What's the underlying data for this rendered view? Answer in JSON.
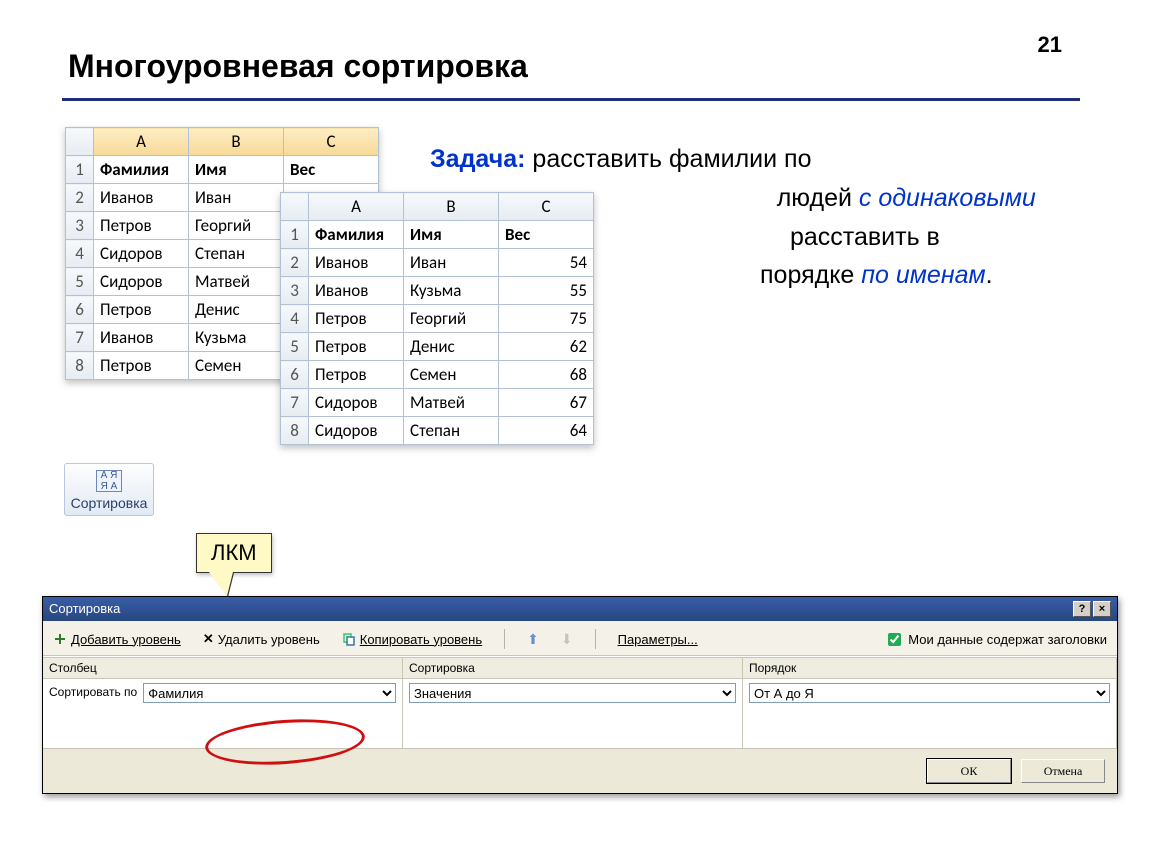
{
  "page_number": "21",
  "title": "Многоуровневая сортировка",
  "task": {
    "label": "Задача:",
    "line1a": "расставить фамилии по",
    "line2a": "людей ",
    "line2b": "с одинаковыми",
    "line3a": "расставить в",
    "line4a": "порядке ",
    "line4b": "по именам",
    "line4c": "."
  },
  "sort_button_label": "Сортировка",
  "callout": "ЛКМ",
  "cols": {
    "A": "A",
    "B": "B",
    "C": "C"
  },
  "headers": {
    "surname": "Фамилия",
    "name": "Имя",
    "weight": "Вес"
  },
  "table1_rows": [
    {
      "n": "1",
      "a": "Фамилия",
      "b": "Имя",
      "c": "Вес",
      "hdr": true
    },
    {
      "n": "2",
      "a": "Иванов",
      "b": "Иван"
    },
    {
      "n": "3",
      "a": "Петров",
      "b": "Георгий"
    },
    {
      "n": "4",
      "a": "Сидоров",
      "b": "Степан"
    },
    {
      "n": "5",
      "a": "Сидоров",
      "b": "Матвей"
    },
    {
      "n": "6",
      "a": "Петров",
      "b": "Денис"
    },
    {
      "n": "7",
      "a": "Иванов",
      "b": "Кузьма"
    },
    {
      "n": "8",
      "a": "Петров",
      "b": "Семен"
    }
  ],
  "table2_rows": [
    {
      "n": "1",
      "a": "Фамилия",
      "b": "Имя",
      "c": "Вес",
      "hdr": true
    },
    {
      "n": "2",
      "a": "Иванов",
      "b": "Иван",
      "c": "54"
    },
    {
      "n": "3",
      "a": "Иванов",
      "b": "Кузьма",
      "c": "55"
    },
    {
      "n": "4",
      "a": "Петров",
      "b": "Георгий",
      "c": "75"
    },
    {
      "n": "5",
      "a": "Петров",
      "b": "Денис",
      "c": "62"
    },
    {
      "n": "6",
      "a": "Петров",
      "b": "Семен",
      "c": "68"
    },
    {
      "n": "7",
      "a": "Сидоров",
      "b": "Матвей",
      "c": "67"
    },
    {
      "n": "8",
      "a": "Сидоров",
      "b": "Степан",
      "c": "64"
    }
  ],
  "dialog": {
    "title": "Сортировка",
    "add_level": "Добавить уровень",
    "del_level": "Удалить уровень",
    "copy_level": "Копировать уровень",
    "params": "Параметры...",
    "headers_chk": "Мои данные содержат заголовки",
    "col_header": "Столбец",
    "sort_header": "Сортировка",
    "order_header": "Порядок",
    "sort_by": "Сортировать по",
    "col_value": "Фамилия",
    "sort_value": "Значения",
    "order_value": "От А до Я",
    "ok": "ОК",
    "cancel": "Отмена"
  }
}
